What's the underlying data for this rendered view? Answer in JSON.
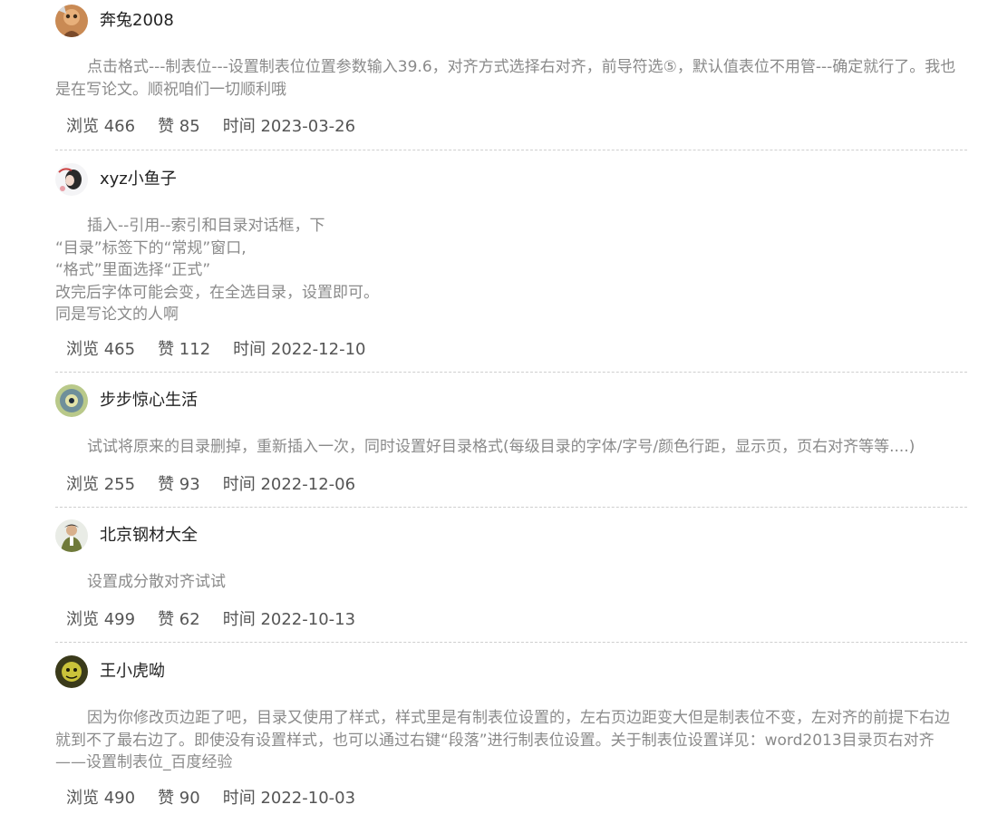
{
  "answers": [
    {
      "author": "奔兔2008",
      "avatar_icon": "avatar-photo",
      "paragraphs": [
        "点击格式---制表位---设置制表位位置参数输入39.6，对齐方式选择右对齐，前导符选⑤，默认值表位不用管---确定就行了。我也是在写论文。顺祝咱们一切顺利哦"
      ],
      "views": "浏览 466",
      "likes": "赞 85",
      "time": "时间 2023-03-26"
    },
    {
      "author": "xyz小鱼子",
      "avatar_icon": "avatar-photo",
      "paragraphs": [
        "插入--引用--索引和目录对话框，下",
        "“目录”标签下的“常规”窗口,",
        "“格式”里面选择“正式”",
        "改完后字体可能会变，在全选目录，设置即可。",
        "同是写论文的人啊"
      ],
      "views": "浏览 465",
      "likes": "赞 112",
      "time": "时间 2022-12-10"
    },
    {
      "author": "步步惊心生活",
      "avatar_icon": "avatar-photo",
      "paragraphs": [
        "试试将原来的目录删掉，重新插入一次，同时设置好目录格式(每级目录的字体/字号/颜色行距，显示页，页右对齐等等....)"
      ],
      "views": "浏览 255",
      "likes": "赞 93",
      "time": "时间 2022-12-06"
    },
    {
      "author": "北京钢材大全",
      "avatar_icon": "avatar-photo",
      "paragraphs": [
        "设置成分散对齐试试"
      ],
      "views": "浏览 499",
      "likes": "赞 62",
      "time": "时间 2022-10-13"
    },
    {
      "author": "王小虎呦",
      "avatar_icon": "avatar-photo",
      "paragraphs": [
        "因为你修改页边距了吧，目录又使用了样式，样式里是有制表位设置的，左右页边距变大但是制表位不变，左对齐的前提下右边就到不了最右边了。即使没有设置样式，也可以通过右键“段落”进行制表位设置。关于制表位设置详见：word2013目录页右对齐——设置制表位_百度经验"
      ],
      "views": "浏览 490",
      "likes": "赞 90",
      "time": "时间 2022-10-03"
    }
  ],
  "colors": {
    "author_text": "#222222",
    "content_text": "#8a8a8a",
    "meta_text": "#555555",
    "divider": "#cfcfcf"
  }
}
